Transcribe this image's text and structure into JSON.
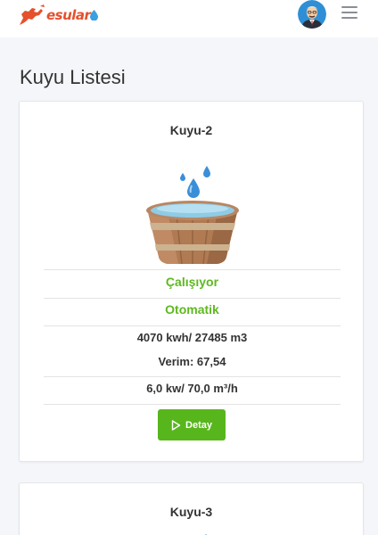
{
  "header": {
    "logo_text": "esular",
    "logo_icon": "horse-icon",
    "avatar_icon": "user-avatar",
    "menu_icon": "hamburger-menu-icon"
  },
  "page": {
    "title": "Kuyu Listesi"
  },
  "wells": [
    {
      "name": "Kuyu-2",
      "image": "water-tub-icon",
      "status": "Çalışıyor",
      "mode": "Otomatik",
      "energy_water": "4070 kwh/ 27485 m3",
      "efficiency": "Verim: 67,54",
      "power_flow": "6,0 kw/ 70,0 m³/h",
      "button_label": "Detay",
      "button_icon": "play-icon"
    },
    {
      "name": "Kuyu-3"
    }
  ],
  "colors": {
    "accent_green": "#5fb820",
    "button_green": "#58b61d",
    "logo_red": "#e5502d"
  }
}
